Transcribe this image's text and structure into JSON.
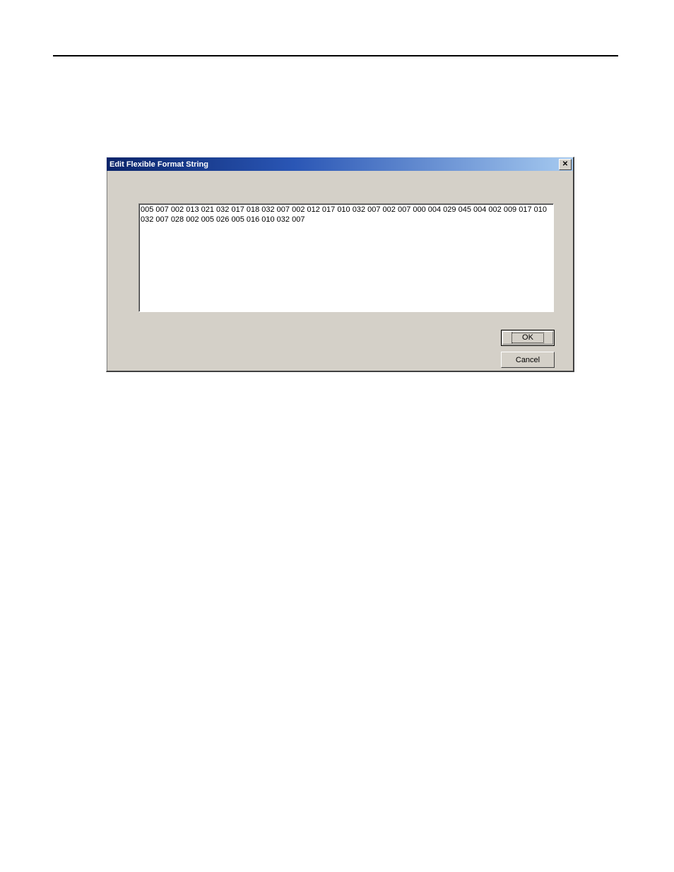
{
  "dialog": {
    "title": "Edit Flexible Format String",
    "textarea_value": "005 007 002 013 021 032 017 018 032 007 002 012 017 010 032 007 002 007 000 004 029 045 004 002 009 017 010 032 007 028 002 005 026 005 016 010 032 007",
    "ok_label": "OK",
    "cancel_label": "Cancel",
    "close_symbol": "✕"
  }
}
